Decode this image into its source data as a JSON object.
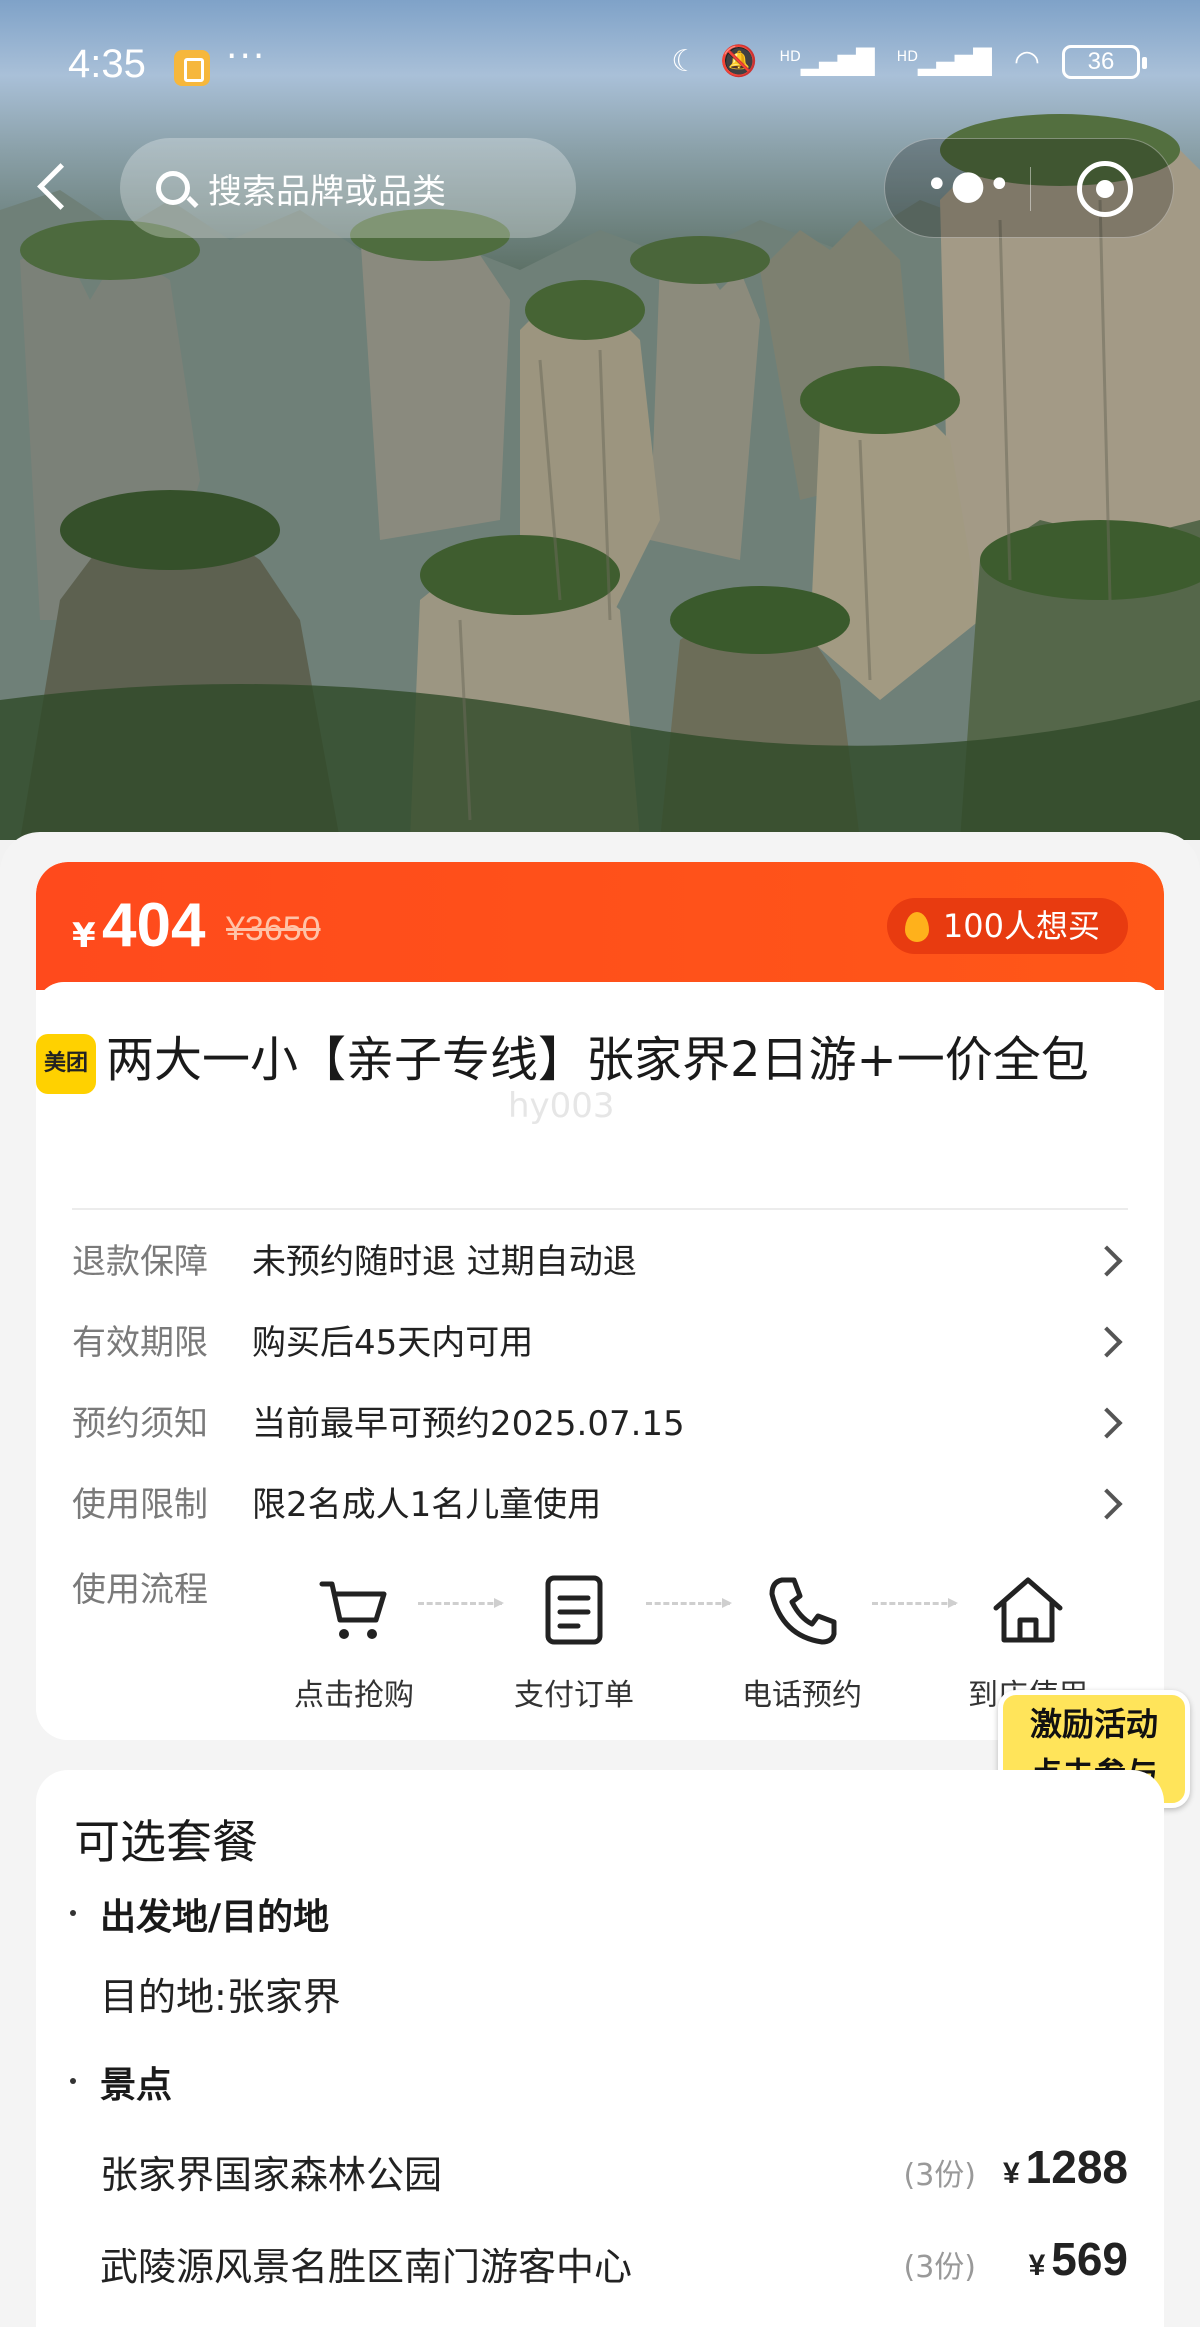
{
  "status_bar": {
    "time": "4:35",
    "dots": "···",
    "battery": "36",
    "hd1": "HD",
    "hd2": "HD"
  },
  "header": {
    "search_placeholder": "搜索品牌或品类",
    "more": "•●•"
  },
  "price": {
    "currency": "¥",
    "current": "404",
    "original": "¥3650",
    "want_count": "100人想买"
  },
  "product": {
    "brand_logo": "美团",
    "title": "两大一小【亲子专线】张家界2日游+一价全包",
    "watermark": "hy003"
  },
  "info_rows": [
    {
      "label": "退款保障",
      "value": "未预约随时退 过期自动退"
    },
    {
      "label": "有效期限",
      "value": "购买后45天内可用"
    },
    {
      "label": "预约须知",
      "value": "当前最早可预约2025.07.15"
    },
    {
      "label": "使用限制",
      "value": "限2名成人1名儿童使用"
    }
  ],
  "flow": {
    "label": "使用流程",
    "steps": [
      "点击抢购",
      "支付订单",
      "电话预约",
      "到店使用"
    ]
  },
  "promo": {
    "line1": "激励活动",
    "line2": "点击参与"
  },
  "packages": {
    "heading": "可选套餐",
    "section1": "出发地/目的地",
    "destination": "目的地:张家界",
    "section2": "景点",
    "items": [
      {
        "name": "张家界国家森林公园",
        "qty": "(3份)",
        "currency": "¥",
        "price": "1288"
      },
      {
        "name": "武陵源风景名胜区南门游客中心",
        "qty": "(3份)",
        "currency": "¥",
        "price": "569"
      }
    ]
  }
}
